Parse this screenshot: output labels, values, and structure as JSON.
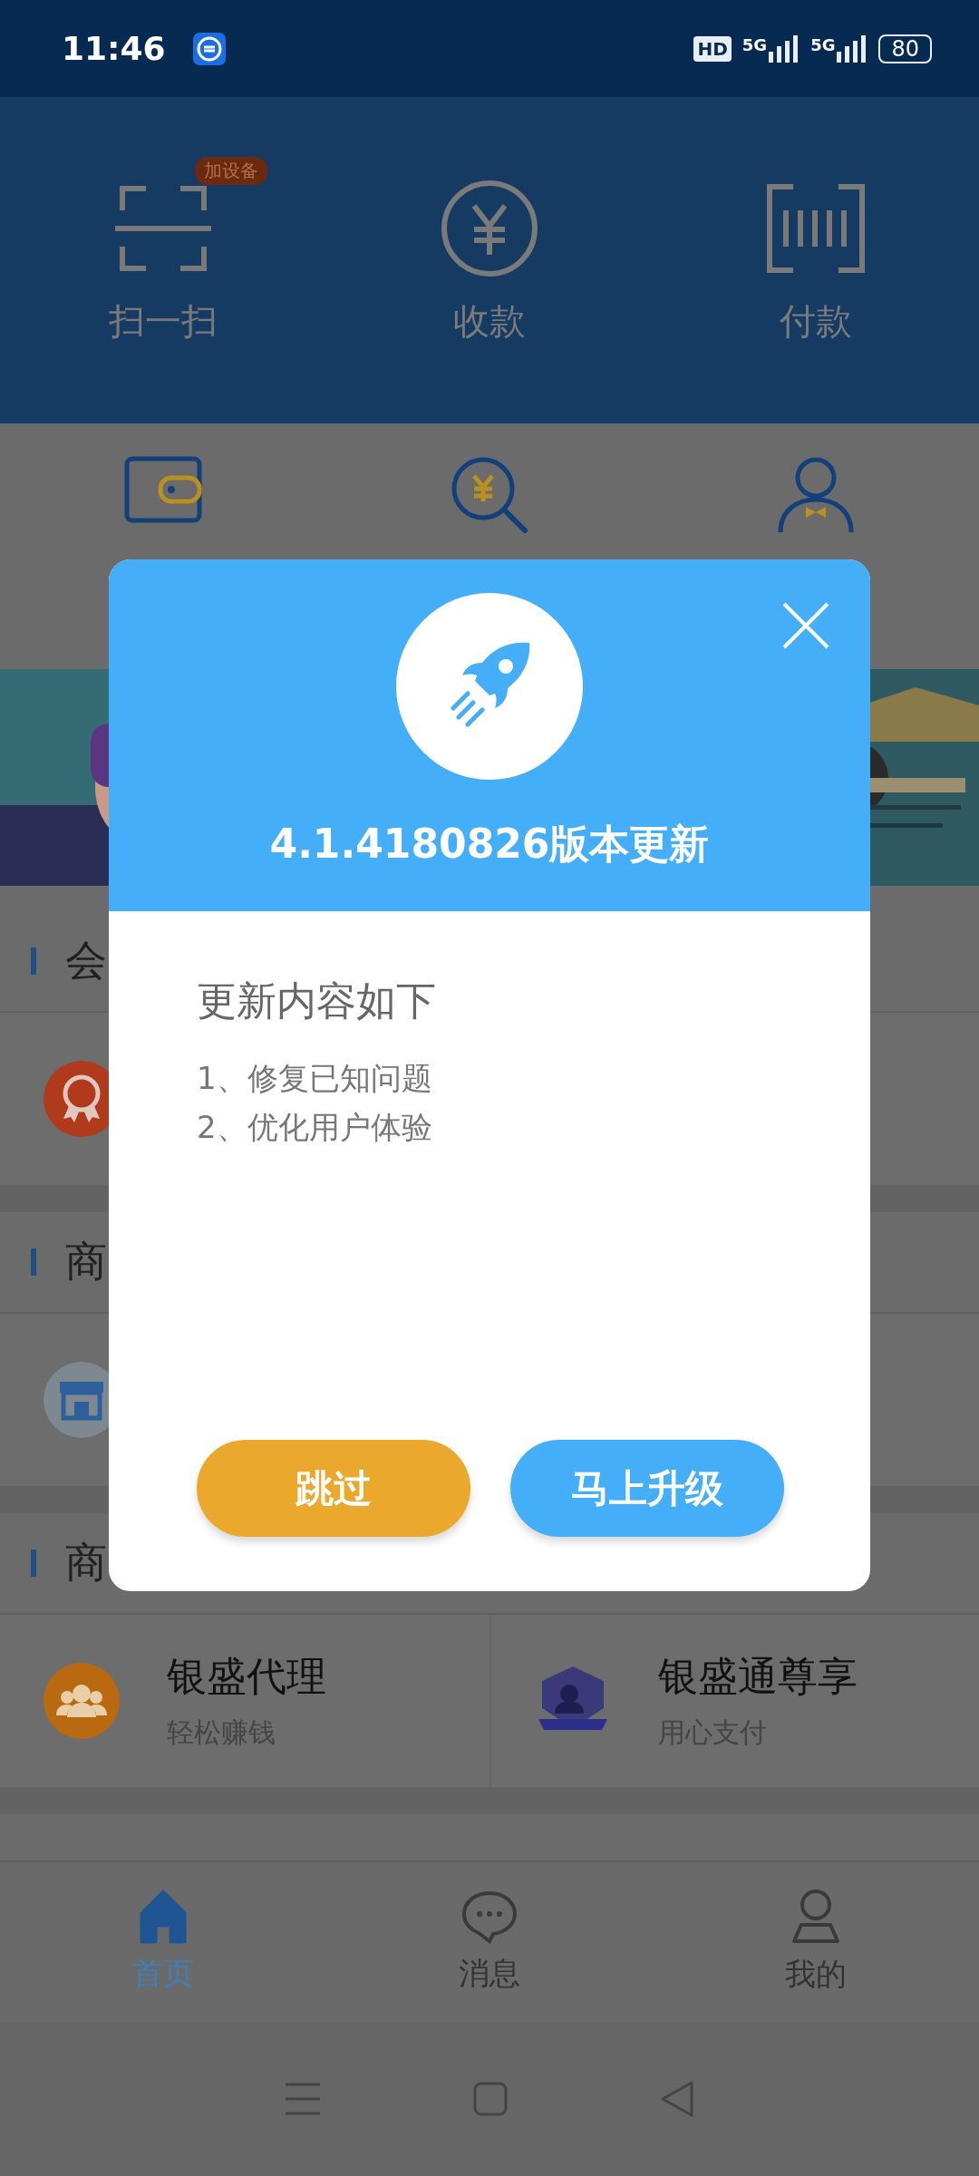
{
  "status_bar": {
    "time": "11:46",
    "hd": "HD",
    "networks": [
      "5G",
      "5G"
    ],
    "battery": "80"
  },
  "header_actions": [
    {
      "label": "扫一扫",
      "badge": "加设备",
      "kind": "scan"
    },
    {
      "label": "收款",
      "kind": "receive"
    },
    {
      "label": "付款",
      "kind": "pay"
    }
  ],
  "shortcuts": [
    {
      "kind": "wallet"
    },
    {
      "kind": "search"
    },
    {
      "kind": "person"
    }
  ],
  "sections": [
    {
      "title": "会",
      "items": [
        {
          "kind": "medal"
        }
      ]
    },
    {
      "title": "商",
      "items": [
        {
          "kind": "shop"
        }
      ]
    },
    {
      "title": "商",
      "items": [
        {
          "kind": "agent",
          "title": "银盛代理",
          "subtitle": "轻松赚钱"
        },
        {
          "kind": "vip",
          "title": "银盛通尊享",
          "subtitle": "用心支付"
        }
      ]
    }
  ],
  "tab_bar": [
    {
      "label": "首页",
      "selected": true,
      "kind": "home"
    },
    {
      "label": "消息",
      "selected": false,
      "kind": "message"
    },
    {
      "label": "我的",
      "selected": false,
      "kind": "me"
    }
  ],
  "dialog": {
    "title": "4.1.4180826版本更新",
    "heading": "更新内容如下",
    "items": [
      "1、修复已知问题",
      "2、优化用户体验"
    ],
    "buttons": [
      {
        "label": "跳过",
        "kind": "skip"
      },
      {
        "label": "马上升级",
        "kind": "primary"
      }
    ]
  }
}
